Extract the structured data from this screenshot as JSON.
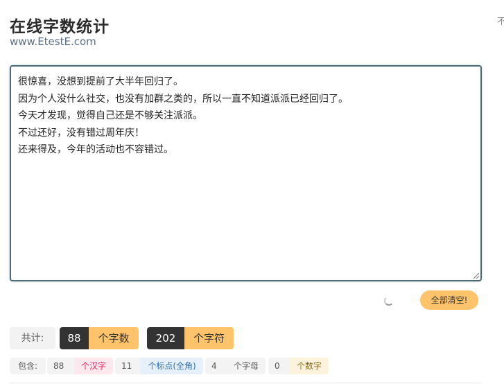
{
  "header": {
    "title": "在线字数统计",
    "subtitle": "www.EtestE.com",
    "edge_glyph": "不"
  },
  "editor": {
    "lines": [
      "很惊喜，没想到提前了大半年回归了。",
      "因为个人没什么社交，也没有加群之类的，所以一直不知道派派已经回归了。",
      "今天才发现，觉得自己还是不够关注派派。",
      "不过还好，没有错过周年庆！",
      "还来得及，今年的活动也不容错过。"
    ]
  },
  "actions": {
    "clear_label": "全部清空!"
  },
  "totals": {
    "label": "共计:",
    "chars": {
      "value": "88",
      "unit": "个字数"
    },
    "symbols": {
      "value": "202",
      "unit": "个字符"
    }
  },
  "breakdown": {
    "label": "包含:",
    "items": [
      {
        "value": "88",
        "unit": "个汉字",
        "color": "#e0245e",
        "bg": "#fde8ee"
      },
      {
        "value": "11",
        "unit": "个标点(全角)",
        "color": "#2f6fb0",
        "bg": "#e6f0fa"
      },
      {
        "value": "4",
        "unit": "个字母",
        "color": "#555555",
        "bg": "#f3f3f3"
      },
      {
        "value": "0",
        "unit": "个数字",
        "color": "#8a6d1a",
        "bg": "#fdf3dc"
      }
    ]
  },
  "colors": {
    "accent": "#ffc46b",
    "dark": "#333333",
    "editor_border": "#4a6a75"
  }
}
